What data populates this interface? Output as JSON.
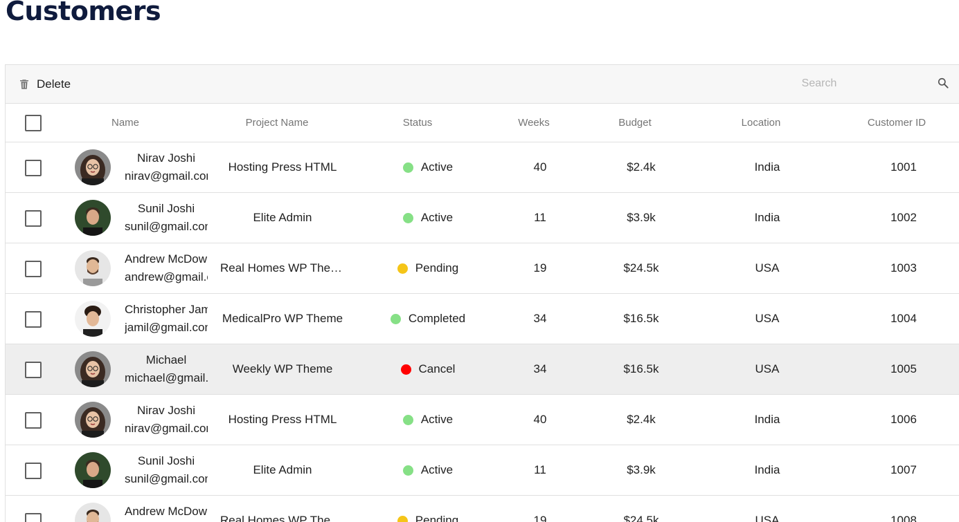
{
  "page_title": "Customers",
  "toolbar": {
    "delete_label": "Delete",
    "search_placeholder": "Search"
  },
  "columns": [
    "Name",
    "Project Name",
    "Status",
    "Weeks",
    "Budget",
    "Location",
    "Customer ID"
  ],
  "status_colors": {
    "Active": "#86e086",
    "Pending": "#f5c518",
    "Completed": "#86e086",
    "Cancel": "#ff0000"
  },
  "rows": [
    {
      "name": "Nirav Joshi",
      "email": "nirav@gmail.com",
      "project": "Hosting Press HTML",
      "status": "Active",
      "weeks": "40",
      "budget": "$2.4k",
      "location": "India",
      "id": "1001",
      "avatar": "woman-glasses"
    },
    {
      "name": "Sunil Joshi",
      "email": "sunil@gmail.com",
      "project": "Elite Admin",
      "status": "Active",
      "weeks": "11",
      "budget": "$3.9k",
      "location": "India",
      "id": "1002",
      "avatar": "man-dark"
    },
    {
      "name": "Andrew McDownland",
      "email": "andrew@gmail.com",
      "project": "Real Homes WP Theme",
      "status": "Pending",
      "weeks": "19",
      "budget": "$24.5k",
      "location": "USA",
      "id": "1003",
      "avatar": "man-beard"
    },
    {
      "name": "Christopher Jamil",
      "email": "jamil@gmail.com",
      "project": "MedicalPro WP Theme",
      "status": "Completed",
      "weeks": "34",
      "budget": "$16.5k",
      "location": "USA",
      "id": "1004",
      "avatar": "man-curly"
    },
    {
      "name": "Michael",
      "email": "michael@gmail.com",
      "project": "Weekly WP Theme",
      "status": "Cancel",
      "weeks": "34",
      "budget": "$16.5k",
      "location": "USA",
      "id": "1005",
      "avatar": "woman-glasses",
      "selected": true
    },
    {
      "name": "Nirav Joshi",
      "email": "nirav@gmail.com",
      "project": "Hosting Press HTML",
      "status": "Active",
      "weeks": "40",
      "budget": "$2.4k",
      "location": "India",
      "id": "1006",
      "avatar": "woman-glasses"
    },
    {
      "name": "Sunil Joshi",
      "email": "sunil@gmail.com",
      "project": "Elite Admin",
      "status": "Active",
      "weeks": "11",
      "budget": "$3.9k",
      "location": "India",
      "id": "1007",
      "avatar": "man-dark"
    },
    {
      "name": "Andrew McDownland",
      "email": "andrew@gmail.com",
      "project": "Real Homes WP Theme",
      "status": "Pending",
      "weeks": "19",
      "budget": "$24.5k",
      "location": "USA",
      "id": "1008",
      "avatar": "man-beard"
    }
  ]
}
